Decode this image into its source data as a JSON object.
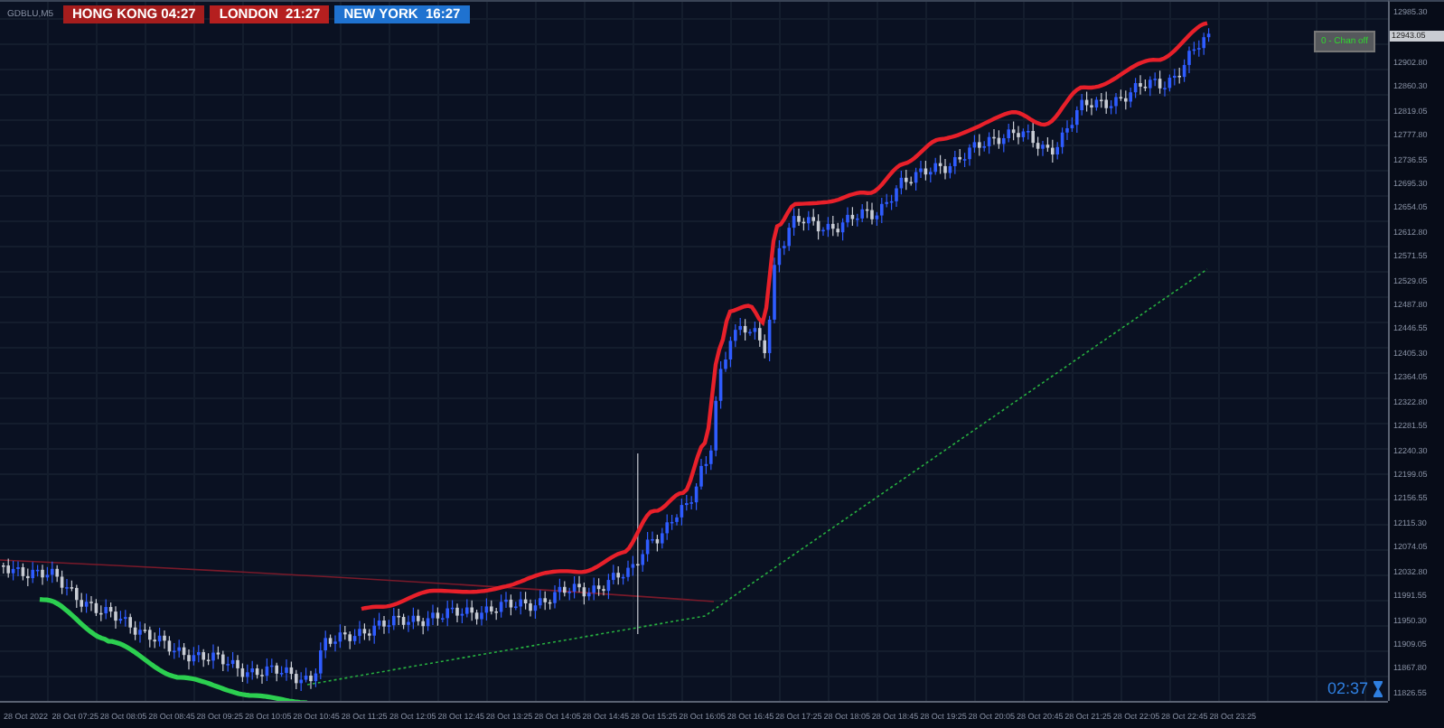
{
  "chart": {
    "symbol": "GDBLU,M5",
    "sessions": [
      {
        "label": "HONG KONG 04:27",
        "color": "#a51d1d"
      },
      {
        "label": "LONDON  21:27",
        "color": "#b51f1f"
      },
      {
        "label": "NEW YORK  16:27",
        "color": "#1f72d0"
      }
    ],
    "indicator_label": "0 - Chan off",
    "countdown": "02:37"
  },
  "price_axis": [
    {
      "text": "12985.30",
      "kind": "tick"
    },
    {
      "text": "12943.05",
      "kind": "current"
    },
    {
      "text": "12902.80",
      "kind": "tick"
    },
    {
      "text": "12860.30",
      "kind": "tick"
    },
    {
      "text": "12819.05",
      "kind": "tick"
    },
    {
      "text": "12777.80",
      "kind": "tick"
    },
    {
      "text": "12736.55",
      "kind": "tick"
    },
    {
      "text": "12695.30",
      "kind": "tick"
    },
    {
      "text": "12654.05",
      "kind": "tick"
    },
    {
      "text": "12612.80",
      "kind": "tick"
    },
    {
      "text": "12571.55",
      "kind": "tick"
    },
    {
      "text": "12529.05",
      "kind": "tick"
    },
    {
      "text": "12487.80",
      "kind": "tick"
    },
    {
      "text": "12446.55",
      "kind": "tick"
    },
    {
      "text": "12405.30",
      "kind": "tick"
    },
    {
      "text": "12364.05",
      "kind": "tick"
    },
    {
      "text": "12322.80",
      "kind": "tick"
    },
    {
      "text": "12281.55",
      "kind": "tick"
    },
    {
      "text": "12240.30",
      "kind": "tick"
    },
    {
      "text": "12199.05",
      "kind": "tick"
    },
    {
      "text": "12156.55",
      "kind": "tick"
    },
    {
      "text": "12115.30",
      "kind": "tick"
    },
    {
      "text": "12074.05",
      "kind": "tick"
    },
    {
      "text": "12032.80",
      "kind": "tick"
    },
    {
      "text": "11991.55",
      "kind": "tick"
    },
    {
      "text": "11950.30",
      "kind": "tick"
    },
    {
      "text": "11909.05",
      "kind": "tick"
    },
    {
      "text": "11867.80",
      "kind": "tick"
    },
    {
      "text": "11826.55",
      "kind": "tick"
    }
  ],
  "time_axis": [
    "28 Oct 2022",
    "28 Oct 07:25",
    "28 Oct 08:05",
    "28 Oct 08:45",
    "28 Oct 09:25",
    "28 Oct 10:05",
    "28 Oct 10:45",
    "28 Oct 11:25",
    "28 Oct 12:05",
    "28 Oct 12:45",
    "28 Oct 13:25",
    "28 Oct 14:05",
    "28 Oct 14:45",
    "28 Oct 15:25",
    "28 Oct 16:05",
    "28 Oct 16:45",
    "28 Oct 17:25",
    "28 Oct 18:05",
    "28 Oct 18:45",
    "28 Oct 19:25",
    "28 Oct 20:05",
    "28 Oct 20:45",
    "28 Oct 21:25",
    "28 Oct 22:05",
    "28 Oct 22:45",
    "28 Oct 23:25"
  ]
}
